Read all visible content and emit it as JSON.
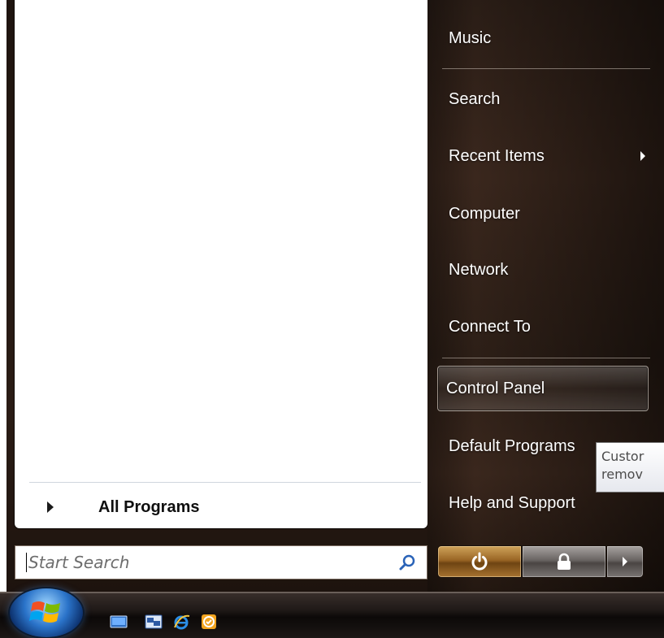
{
  "right_menu": {
    "items": [
      {
        "label": "Music"
      },
      {
        "label": "Search"
      },
      {
        "label": "Recent Items"
      },
      {
        "label": "Computer"
      },
      {
        "label": "Network"
      },
      {
        "label": "Connect To"
      },
      {
        "label": "Control Panel"
      },
      {
        "label": "Default Programs"
      },
      {
        "label": "Help and Support"
      }
    ],
    "tooltip_lines": [
      "Custor",
      "remov"
    ]
  },
  "left_pane": {
    "all_programs_label": "All Programs",
    "search_placeholder": "Start Search"
  },
  "icons": {
    "search": "search-icon",
    "power": "power-icon",
    "lock": "lock-icon",
    "arrow": "arrow-right-icon",
    "start": "windows-start-orb",
    "quick_launch": [
      "show-desktop-icon",
      "switch-windows-icon",
      "internet-explorer-icon",
      "outlook-icon"
    ]
  },
  "colors": {
    "panel_dark": "#2a1d16",
    "power_amber": "#9a6625",
    "start_blue": "#2a73c9",
    "text_white": "#ffffff"
  }
}
